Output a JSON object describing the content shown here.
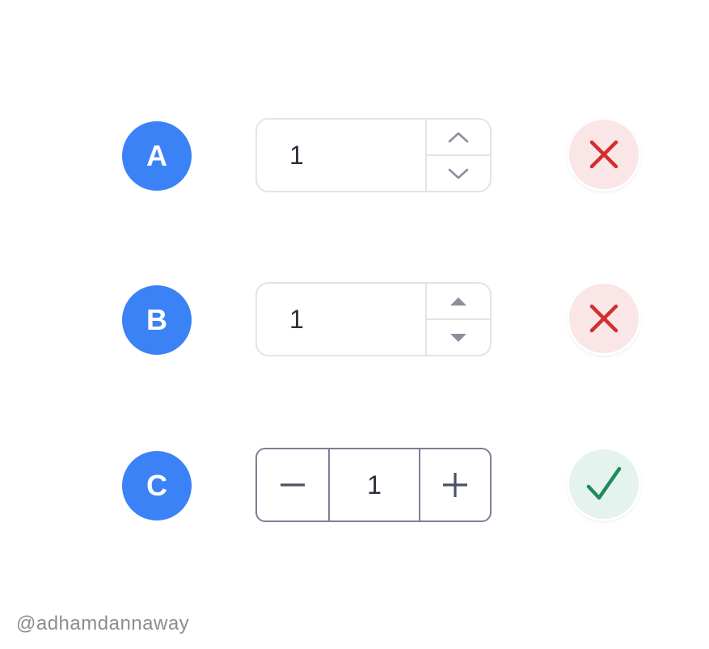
{
  "options": [
    {
      "id": "A",
      "label": "A",
      "value": "1",
      "control_style": "spinner with chevron arrows",
      "up_icon": "chevron-up-icon",
      "down_icon": "chevron-down-icon",
      "verdict": "incorrect",
      "verdict_icon": "cross-icon"
    },
    {
      "id": "B",
      "label": "B",
      "value": "1",
      "control_style": "spinner with triangle arrows",
      "up_icon": "triangle-up-icon",
      "down_icon": "triangle-down-icon",
      "verdict": "incorrect",
      "verdict_icon": "cross-icon"
    },
    {
      "id": "C",
      "label": "C",
      "value": "1",
      "control_style": "minus / value / plus buttons",
      "decrement_icon": "minus-icon",
      "increment_icon": "plus-icon",
      "verdict": "correct",
      "verdict_icon": "checkmark-icon"
    }
  ],
  "credit": "@adhamdannaway",
  "colors": {
    "badge": "#3b82f6",
    "wrong": "#d32f2f",
    "wrong_bg": "#fae6e6",
    "right": "#1f8a5b",
    "right_bg": "#e5f3ee",
    "soft_border": "#e3e4ea",
    "hard_border": "#7c8094",
    "text": "#2b2f3a",
    "credit": "#8a8d96"
  }
}
